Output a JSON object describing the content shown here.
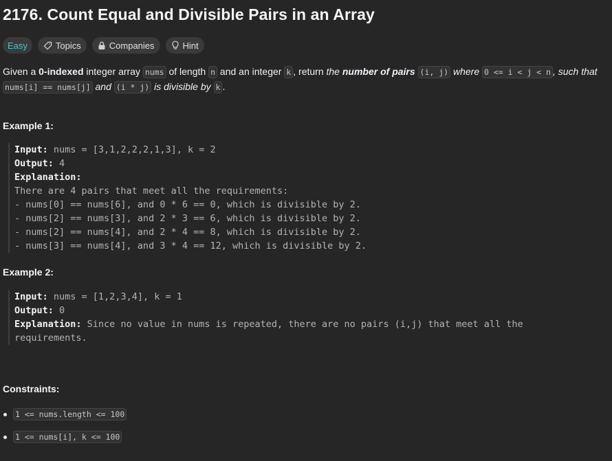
{
  "title": "2176. Count Equal and Divisible Pairs in an Array",
  "tags": {
    "difficulty": "Easy",
    "topics": "Topics",
    "companies": "Companies",
    "hint": "Hint"
  },
  "description": {
    "p1": "Given a ",
    "b1": "0-indexed",
    "p2": " integer array ",
    "c_nums": "nums",
    "p3": " of length ",
    "c_n": "n",
    "p4": " and an integer ",
    "c_k": "k",
    "p5": ", return ",
    "i1": "the ",
    "ib1": "number of pairs",
    "c_pair": "(i, j)",
    "i2": " where ",
    "c_cond": "0 <= i < j < n",
    "i3": ", such that ",
    "c_eq": "nums[i] == nums[j]",
    "i4": " and ",
    "c_prod": "(i * j)",
    "i5": " is divisible by ",
    "c_k2": "k",
    "p6": "."
  },
  "example1": {
    "heading": "Example 1:",
    "input_label": "Input:",
    "input_value": " nums = [3,1,2,2,2,1,3], k = 2",
    "output_label": "Output:",
    "output_value": " 4",
    "explanation_label": "Explanation:",
    "lines": [
      "There are 4 pairs that meet all the requirements:",
      "- nums[0] == nums[6], and 0 * 6 == 0, which is divisible by 2.",
      "- nums[2] == nums[3], and 2 * 3 == 6, which is divisible by 2.",
      "- nums[2] == nums[4], and 2 * 4 == 8, which is divisible by 2.",
      "- nums[3] == nums[4], and 3 * 4 == 12, which is divisible by 2."
    ]
  },
  "example2": {
    "heading": "Example 2:",
    "input_label": "Input:",
    "input_value": " nums = [1,2,3,4], k = 1",
    "output_label": "Output:",
    "output_value": " 0",
    "explanation_label": "Explanation:",
    "explanation_value": " Since no value in nums is repeated, there are no pairs (i,j) that meet all the",
    "explanation_cont": "requirements."
  },
  "constraints": {
    "heading": "Constraints:",
    "items": [
      "1 <= nums.length <= 100",
      "1 <= nums[i], k <= 100"
    ]
  },
  "colors": {
    "background": "#262626",
    "easy": "#46c6c2",
    "tag_bg": "#3a3a3a"
  }
}
